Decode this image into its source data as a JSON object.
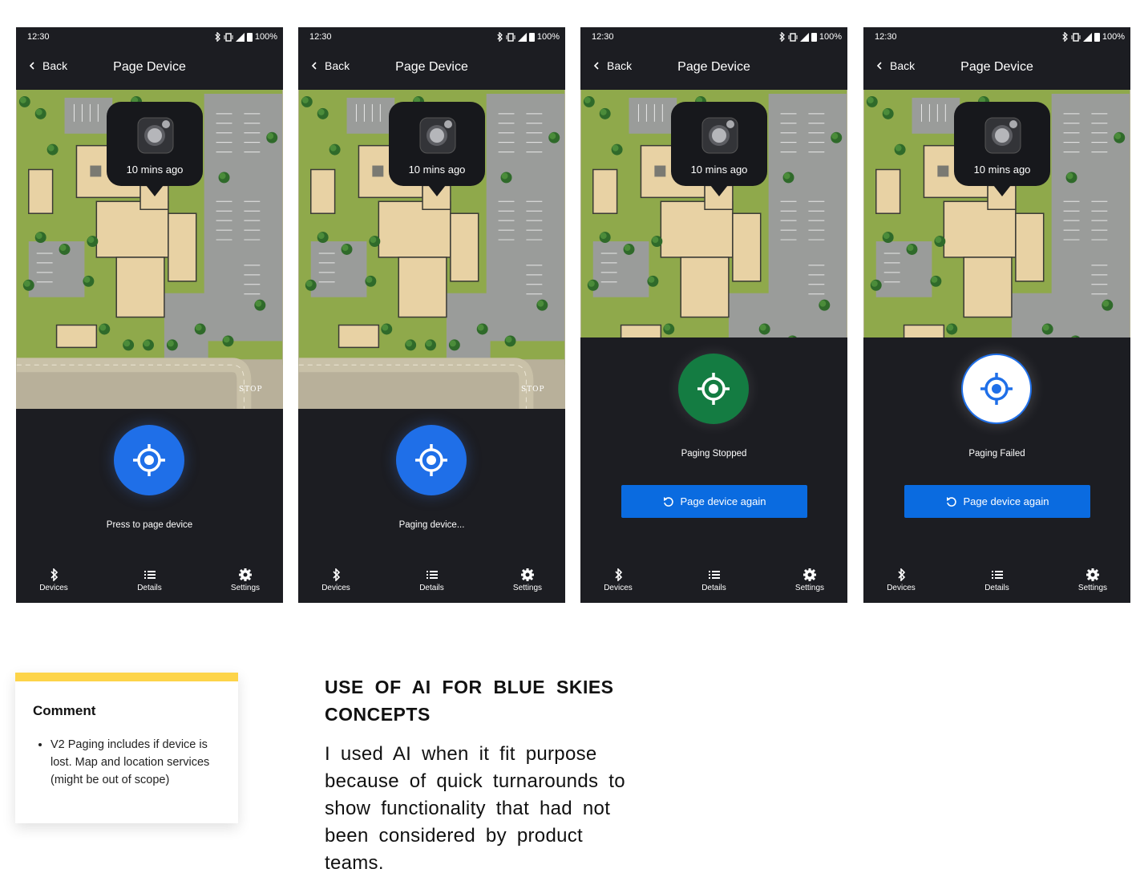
{
  "common": {
    "time": "12:30",
    "battery": "100%",
    "back_label": "Back",
    "page_title": "Page Device",
    "popup_time": "10 mins ago",
    "stop_sign": "STOP",
    "nav": {
      "devices": "Devices",
      "details": "Details",
      "settings": "Settings"
    }
  },
  "screens": [
    {
      "state": "Press to page device"
    },
    {
      "state": "Paging device..."
    },
    {
      "state": "Paging Stopped",
      "again_label": "Page device again"
    },
    {
      "state": "Paging Failed",
      "again_label": "Page device again"
    }
  ],
  "comment": {
    "title": "Comment",
    "text": "V2 Paging includes if device is lost. Map and location services (might be out of scope)"
  },
  "heading": "USE OF AI FOR BLUE SKIES CONCEPTS",
  "body": "I used AI when it fit purpose because of quick turnarounds to show functionality that had not been considered by product teams."
}
